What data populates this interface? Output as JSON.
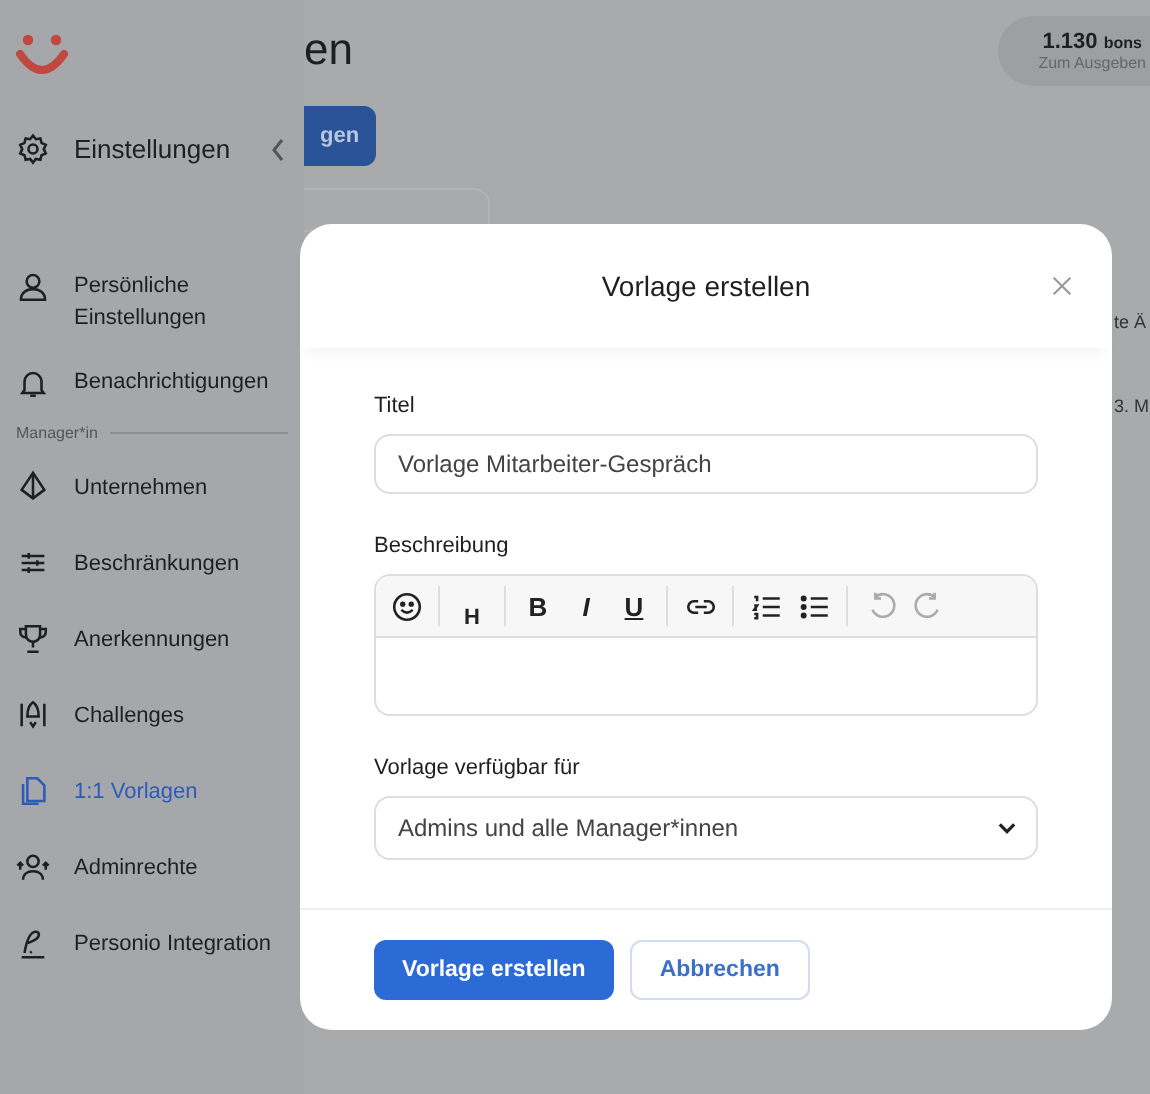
{
  "sidebar": {
    "header": "Einstellungen",
    "top_items": [
      {
        "label": "Persönliche Einstellungen",
        "selected": false
      },
      {
        "label": "Benachrichtigungen",
        "selected": false
      }
    ],
    "section_label": "Manager*in",
    "items": [
      {
        "label": "Unternehmen",
        "selected": false
      },
      {
        "label": "Beschränkungen",
        "selected": false
      },
      {
        "label": "Anerkennungen",
        "selected": false
      },
      {
        "label": "Challenges",
        "selected": false
      },
      {
        "label": "1:1 Vorlagen",
        "selected": true
      },
      {
        "label": "Adminrechte",
        "selected": false
      },
      {
        "label": "Personio Integration",
        "selected": false
      }
    ]
  },
  "background": {
    "heading": "en",
    "button": "gen",
    "points": {
      "amount": "1.130",
      "unit": "bons",
      "caption": "Zum Ausgeben"
    },
    "table_fragments": [
      "te Ä",
      "3. M"
    ]
  },
  "modal": {
    "title": "Vorlage erstellen",
    "title_field": {
      "label": "Titel",
      "value": "Vorlage Mitarbeiter-Gespräch"
    },
    "description": {
      "label": "Beschreibung",
      "toolbar": [
        {
          "kind": "emoji",
          "disabled": false
        },
        {
          "kind": "heading",
          "label": "H",
          "disabled": false
        },
        {
          "kind": "bold",
          "label": "B",
          "disabled": false
        },
        {
          "kind": "italic",
          "label": "I",
          "disabled": false
        },
        {
          "kind": "underline",
          "label": "U",
          "disabled": false
        },
        {
          "kind": "link",
          "disabled": false
        },
        {
          "kind": "numbered",
          "disabled": false
        },
        {
          "kind": "bulleted",
          "disabled": false
        },
        {
          "kind": "undo",
          "disabled": true
        },
        {
          "kind": "redo",
          "disabled": true
        }
      ]
    },
    "availability": {
      "label": "Vorlage verfügbar für",
      "value": "Admins und alle Manager*innen"
    },
    "buttons": [
      {
        "kind": "primary",
        "label": "Vorlage erstellen"
      },
      {
        "kind": "secondary",
        "label": "Abbrechen"
      }
    ]
  }
}
